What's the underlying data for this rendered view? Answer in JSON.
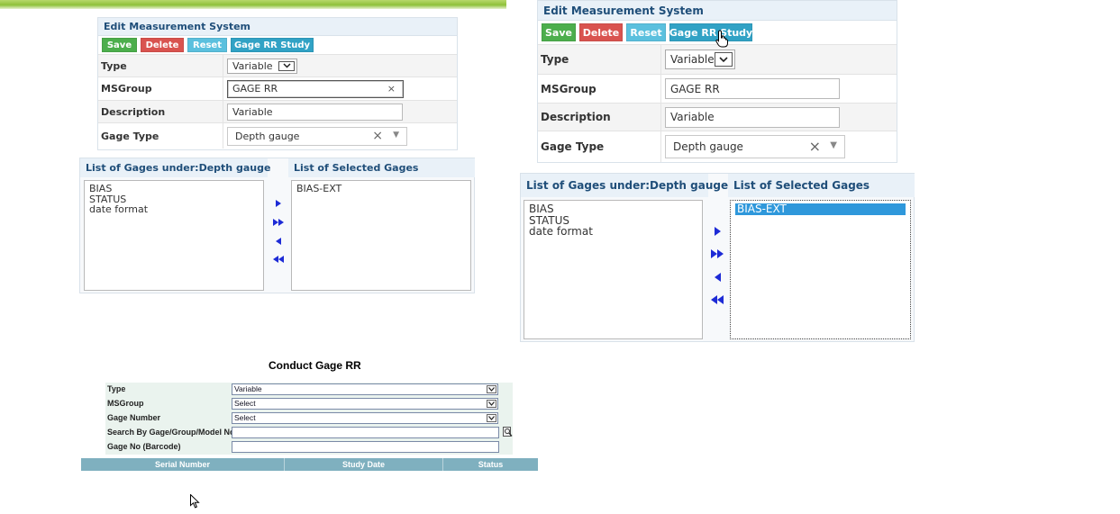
{
  "left_form": {
    "header": "Edit Measurement System",
    "buttons": {
      "save": "Save",
      "delete": "Delete",
      "reset": "Reset",
      "study": "Gage RR Study"
    },
    "fields": {
      "type_label": "Type",
      "type_value": "Variable",
      "msgroup_label": "MSGroup",
      "msgroup_value": "GAGE RR",
      "description_label": "Description",
      "description_value": "Variable",
      "gagetype_label": "Gage Type",
      "gagetype_value": "Depth gauge"
    },
    "lists": {
      "available_header": "List of Gages under:Depth gauge",
      "selected_header": "List of Selected Gages",
      "available_items": [
        "BIAS",
        "STATUS",
        "date format"
      ],
      "selected_items": [
        "BIAS-EXT"
      ]
    }
  },
  "right_form": {
    "header": "Edit Measurement System",
    "buttons": {
      "save": "Save",
      "delete": "Delete",
      "reset": "Reset",
      "study": "Gage RR Study"
    },
    "fields": {
      "type_label": "Type",
      "type_value": "Variable",
      "msgroup_label": "MSGroup",
      "msgroup_value": "GAGE RR",
      "description_label": "Description",
      "description_value": "Variable",
      "gagetype_label": "Gage Type",
      "gagetype_value": "Depth gauge"
    },
    "lists": {
      "available_header": "List of Gages under:Depth gauge",
      "selected_header": "List of Selected Gages",
      "available_items": [
        "BIAS",
        "STATUS",
        "date format"
      ],
      "selected_items": [
        "BIAS-EXT"
      ]
    }
  },
  "conduct": {
    "title": "Conduct Gage RR",
    "rows": {
      "type_label": "Type",
      "type_value": "Variable",
      "msgroup_label": "MSGroup",
      "msgroup_value": "Select",
      "gagenumber_label": "Gage Number",
      "gagenumber_value": "Select",
      "search_label": "Search By Gage/Group/Model No",
      "barcode_label": "Gage No (Barcode)"
    },
    "table_columns": [
      "Serial Number",
      "Study Date",
      "Status"
    ]
  },
  "icons": {
    "move_right": "move-right-icon",
    "move_all_right": "move-all-right-icon",
    "move_left": "move-left-icon",
    "move_all_left": "move-all-left-icon",
    "clear": "clear-icon",
    "dropdown": "chevron-down-icon",
    "search": "search-icon",
    "hand_cursor": "hand-cursor-icon",
    "arrow_cursor": "arrow-cursor-icon"
  },
  "colors": {
    "save": "#4cae4c",
    "delete": "#d9534f",
    "reset": "#5bc0de",
    "study": "#31a2c5",
    "header_text": "#1f4e79",
    "selected_item": "#2f98db",
    "table_head": "#7fb0bf"
  }
}
